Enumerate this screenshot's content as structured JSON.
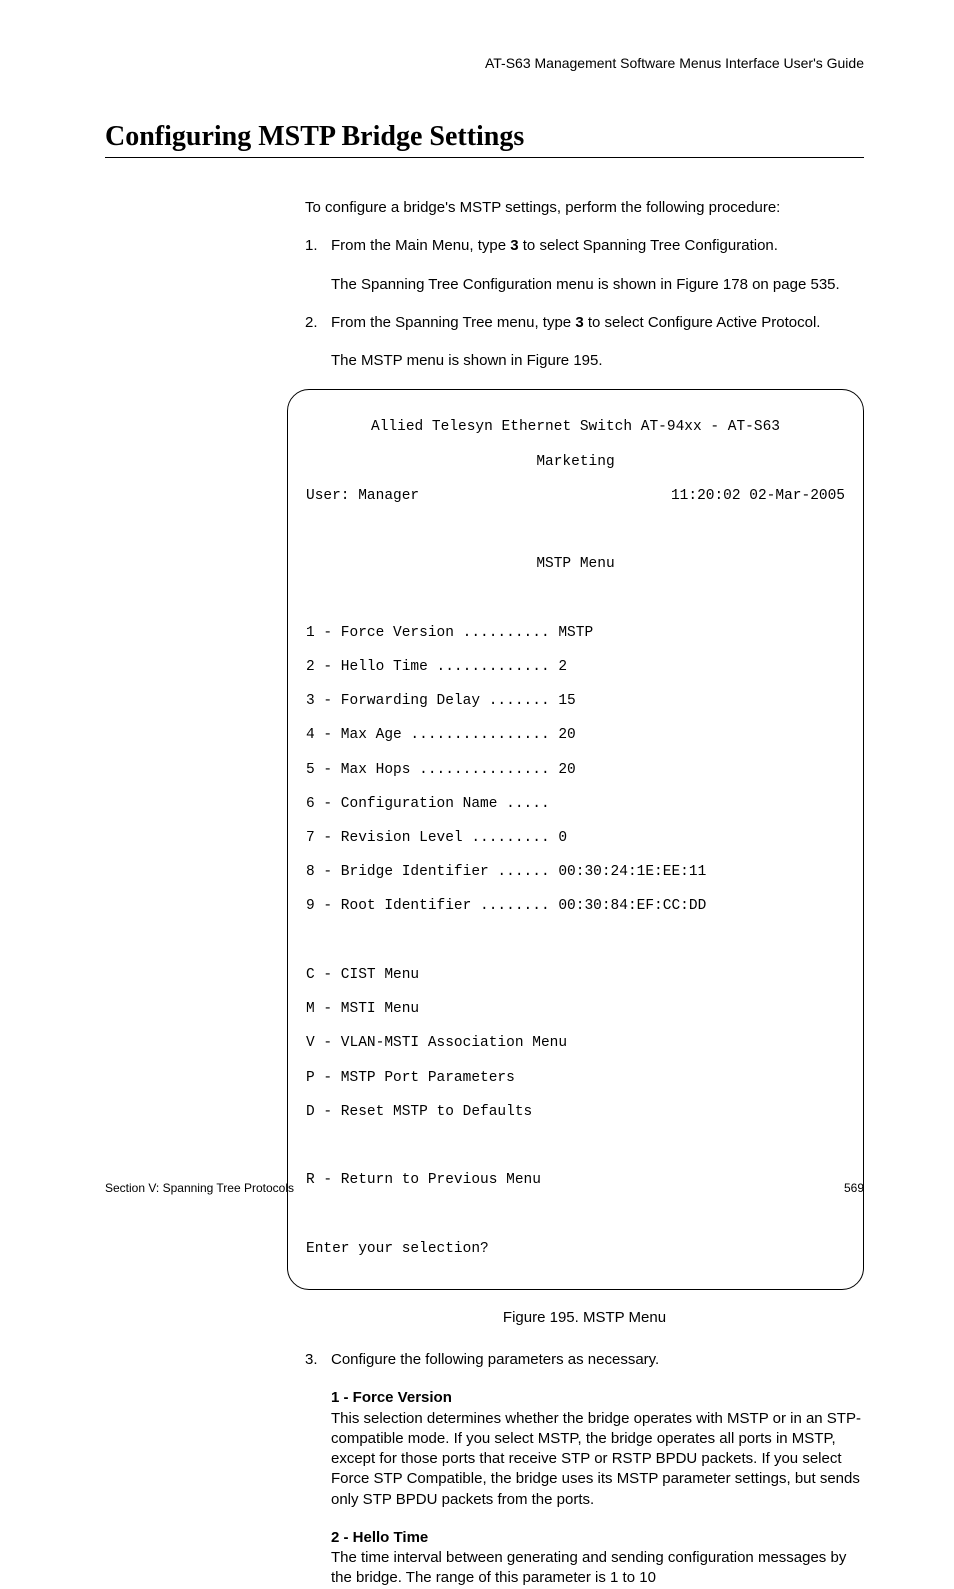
{
  "header": "AT-S63 Management Software Menus Interface User's Guide",
  "section_title": "Configuring MSTP Bridge Settings",
  "intro": "To configure a bridge's MSTP settings, perform the following procedure:",
  "steps": {
    "s1_num": "1.",
    "s1_a": "From the Main Menu, type ",
    "s1_b": "3",
    "s1_c": " to select Spanning Tree Configuration.",
    "s1_note": "The Spanning Tree Configuration menu is shown in Figure 178 on page 535.",
    "s2_num": "2.",
    "s2_a": "From the Spanning Tree menu, type ",
    "s2_b": "3",
    "s2_c": " to select Configure Active Protocol.",
    "s2_note": "The MSTP menu is shown in Figure 195.",
    "s3_num": "3.",
    "s3_text": "Configure the following parameters as necessary."
  },
  "terminal": {
    "title1": "Allied Telesyn Ethernet Switch AT-94xx - AT-S63",
    "title2": "Marketing",
    "user": "User: Manager",
    "datetime": "11:20:02 02-Mar-2005",
    "menutitle": "MSTP Menu",
    "l1": "1 - Force Version .......... MSTP",
    "l2": "2 - Hello Time ............. 2",
    "l3": "3 - Forwarding Delay ....... 15",
    "l4": "4 - Max Age ................ 20",
    "l5": "5 - Max Hops ............... 20",
    "l6": "6 - Configuration Name .....",
    "l7": "7 - Revision Level ......... 0",
    "l8": "8 - Bridge Identifier ...... 00:30:24:1E:EE:11",
    "l9": "9 - Root Identifier ........ 00:30:84:EF:CC:DD",
    "lc": "C - CIST Menu",
    "lm": "M - MSTI Menu",
    "lv": "V - VLAN-MSTI Association Menu",
    "lp": "P - MSTP Port Parameters",
    "ld": "D - Reset MSTP to Defaults",
    "lr": "R - Return to Previous Menu",
    "prompt": "Enter your selection?"
  },
  "figure_caption": "Figure 195. MSTP Menu",
  "params": {
    "p1_title": "1 - Force Version",
    "p1_body": "This selection determines whether the bridge operates with MSTP or in an STP-compatible mode. If you select MSTP, the bridge operates all ports in MSTP, except for those ports that receive STP or RSTP BPDU packets. If you select Force STP Compatible, the bridge uses its MSTP parameter settings, but sends only STP BPDU packets from the ports.",
    "p2_title": "2 - Hello Time",
    "p2_body": "The time interval between generating and sending configuration messages by the bridge. The range of this parameter is 1 to 10"
  },
  "footer": {
    "left": "Section V: Spanning Tree Protocols",
    "right": "569"
  }
}
